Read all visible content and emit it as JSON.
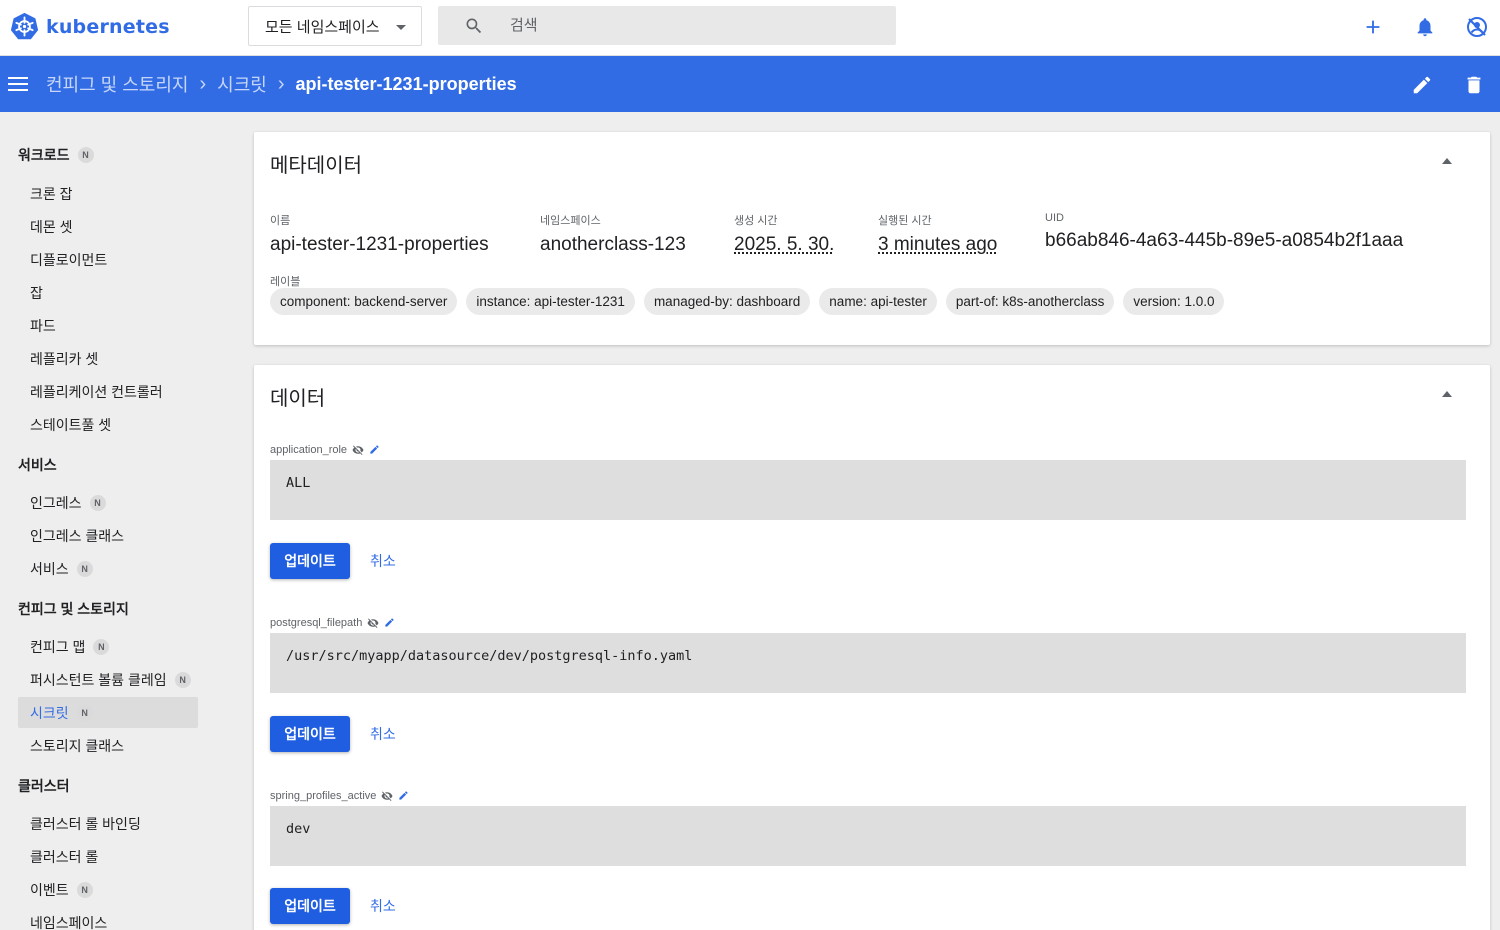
{
  "app": {
    "name": "kubernetes",
    "brand_color": "#326ce5"
  },
  "header": {
    "namespace_selector": "모든 네임스페이스",
    "search_placeholder": "검색",
    "actions": [
      "plus-icon",
      "bell-icon",
      "account-icon"
    ]
  },
  "breadcrumb": {
    "items": [
      "컨피그 및 스토리지",
      "시크릿"
    ],
    "current": "api-tester-1231-properties",
    "actions": [
      "edit-icon",
      "delete-icon"
    ]
  },
  "sidebar": {
    "groups": [
      {
        "label": "워크로드",
        "badge": "N"
      },
      {
        "label": "서비스"
      },
      {
        "label": "컨피그 및 스토리지"
      },
      {
        "label": "클러스터"
      }
    ],
    "items": [
      {
        "label": "크론 잡"
      },
      {
        "label": "데몬 셋"
      },
      {
        "label": "디플로이먼트"
      },
      {
        "label": "잡"
      },
      {
        "label": "파드"
      },
      {
        "label": "레플리카 셋"
      },
      {
        "label": "레플리케이션 컨트롤러"
      },
      {
        "label": "스테이트풀 셋"
      },
      {
        "label": "인그레스",
        "badge": "N"
      },
      {
        "label": "인그레스 클래스"
      },
      {
        "label": "서비스",
        "badge": "N"
      },
      {
        "label": "컨피그 맵",
        "badge": "N"
      },
      {
        "label": "퍼시스턴트 볼륨 클레임",
        "badge": "N"
      },
      {
        "label": "시크릿",
        "badge": "N",
        "active": true
      },
      {
        "label": "스토리지 클래스"
      },
      {
        "label": "클러스터 롤 바인딩"
      },
      {
        "label": "클러스터 롤"
      },
      {
        "label": "이벤트",
        "badge": "N"
      },
      {
        "label": "네임스페이스"
      }
    ]
  },
  "metadata": {
    "title": "메타데이터",
    "fields": [
      {
        "label": "이름",
        "value": "api-tester-1231-properties"
      },
      {
        "label": "네임스페이스",
        "value": "anotherclass-123"
      },
      {
        "label": "생성 시간",
        "value": "2025. 5. 30."
      },
      {
        "label": "실행된 시간",
        "value": "3 minutes ago"
      },
      {
        "label": "UID",
        "value": "b66ab846-4a63-445b-89e5-a0854b2f1aaa"
      }
    ],
    "labels_title": "레이블",
    "labels": [
      "component: backend-server",
      "instance: api-tester-1231",
      "managed-by: dashboard",
      "name: api-tester",
      "part-of: k8s-anotherclass",
      "version: 1.0.0"
    ]
  },
  "data": {
    "title": "데이터",
    "update_label": "업데이트",
    "cancel_label": "취소",
    "entries": [
      {
        "key": "application_role",
        "value": "ALL"
      },
      {
        "key": "postgresql_filepath",
        "value": "/usr/src/myapp/datasource/dev/postgresql-info.yaml"
      },
      {
        "key": "spring_profiles_active",
        "value": "dev"
      }
    ]
  }
}
